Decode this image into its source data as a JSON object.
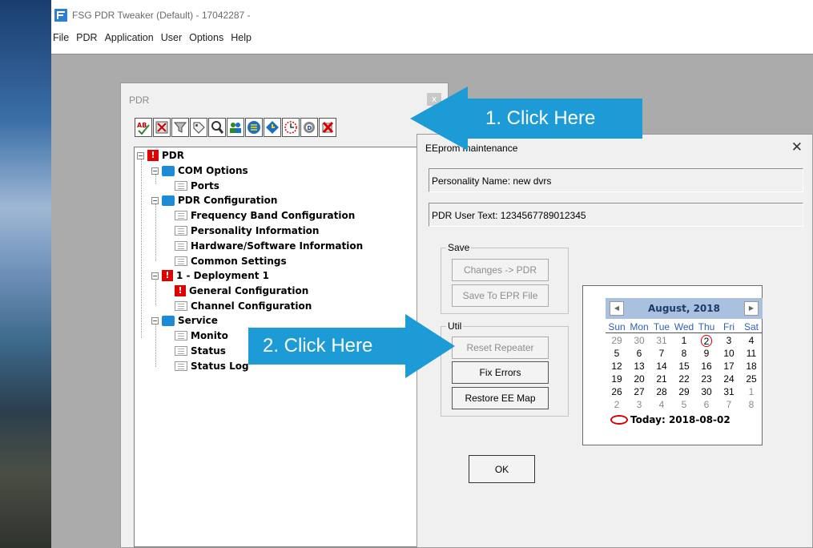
{
  "app": {
    "title": "FSG PDR Tweaker (Default) - 17042287 -",
    "menu": [
      "File",
      "PDR",
      "Application",
      "User",
      "Options",
      "Help"
    ]
  },
  "pdr_window": {
    "title": "PDR",
    "close": "x",
    "toolbar_icons": [
      "spell-check-icon",
      "tools-icon",
      "filter-icon",
      "tag-icon",
      "search-icon",
      "users-icon",
      "list-icon",
      "clock-icon",
      "calendar-icon",
      "settings-icon",
      "delete-icon"
    ],
    "tree": {
      "root": "PDR",
      "com_options": "COM Options",
      "ports": "Ports",
      "pdr_configuration": "PDR Configuration",
      "frequency_band": "Frequency Band Configuration",
      "personality_info": "Personality Information",
      "hw_sw_info": "Hardware/Software Information",
      "common_settings": "Common Settings",
      "deployment": "1 - Deployment 1",
      "general_config": "General Configuration",
      "channel_config": "Channel Configuration",
      "service": "Service",
      "monitor": "Monito",
      "status": "Status",
      "status_log": "Status Log"
    }
  },
  "dialog": {
    "title": "EEprom maintenance",
    "close": "✕",
    "personality_name": "Personality Name: new dvrs",
    "user_text": "PDR User Text: 1234567789012345",
    "save_group": "Save",
    "changes_to_pdr": "Changes -> PDR",
    "save_to_epr": "Save To EPR File",
    "util_group": "Util",
    "reset_repeater": "Reset Repeater",
    "fix_errors": "Fix Errors",
    "restore_ee_map": "Restore EE Map",
    "ok": "OK"
  },
  "calendar": {
    "month": "August, 2018",
    "prev": "◀",
    "next": "▶",
    "dows": [
      "Sun",
      "Mon",
      "Tue",
      "Wed",
      "Thu",
      "Fri",
      "Sat"
    ],
    "days": [
      "29",
      "30",
      "31",
      "1",
      "2",
      "3",
      "4",
      "5",
      "6",
      "7",
      "8",
      "9",
      "10",
      "11",
      "12",
      "13",
      "14",
      "15",
      "16",
      "17",
      "18",
      "19",
      "20",
      "21",
      "22",
      "23",
      "24",
      "25",
      "26",
      "27",
      "28",
      "29",
      "30",
      "31",
      "1",
      "2",
      "3",
      "4",
      "5",
      "6",
      "7",
      "8"
    ],
    "today": "Today: 2018-08-02"
  },
  "callouts": {
    "one": "1.  Click Here",
    "two": "2.  Click Here"
  },
  "colors": {
    "callout": "#1c9bd7",
    "error": "#e00000",
    "folder": "#1c8ad6",
    "cal_header": "#a9c1df"
  }
}
